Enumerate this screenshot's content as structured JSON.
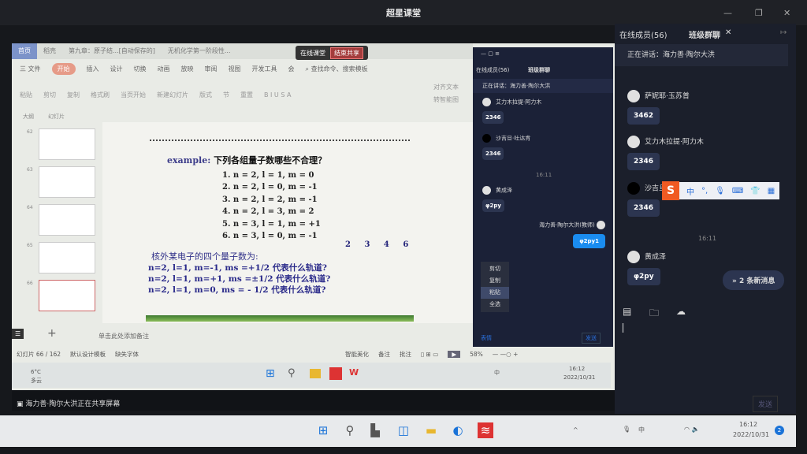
{
  "app": {
    "title": "超星课堂"
  },
  "wps": {
    "tabs": [
      "首页",
      "稻壳",
      "第九章：原子结...[自动保存的]",
      "无机化学第一阶段性..."
    ],
    "live_indicator": "在线课堂",
    "stop_share": "结束共享",
    "menu": [
      "三 文件",
      "开始",
      "插入",
      "设计",
      "切换",
      "动画",
      "放映",
      "审阅",
      "视图",
      "开发工具",
      "会"
    ],
    "search_placeholder": "查找命令、搜索模板",
    "ribbon": [
      "粘贴",
      "剪切",
      "复制",
      "格式刷",
      "当页开始",
      "新建幻灯片",
      "版式",
      "节",
      "重置",
      "对齐文本",
      "转智能图"
    ],
    "outline_tabs": [
      "大纲",
      "幻灯片"
    ],
    "thumb_numbers": [
      "62",
      "63",
      "64",
      "65",
      "66"
    ],
    "notes_placeholder": "单击此处添加备注",
    "status": {
      "slide": "幻灯片 66 / 162",
      "template": "默认设计模板",
      "font": "缺失字体",
      "beautify": "智能美化",
      "notes": "备注",
      "comment": "批注",
      "zoom": "58%"
    }
  },
  "slide": {
    "example_label": "example:",
    "example_question": "下列各组量子数哪些不合理？",
    "items": [
      "1. n = 2, l = 1, m = 0",
      "2. n = 2, l = 0, m = -1",
      "3. n = 2, l = 2, m = -1",
      "4. n = 2, l = 3, m = 2",
      "5. n = 3, l = 1, m = +1",
      "6. n = 3, l = 0, m = -1"
    ],
    "answers": "2 3 4 6",
    "q_title": "核外某电子的四个量子数为:",
    "questions": [
      "n=2, l=1, m=-1, ms =+1/2 代表什么轨道?",
      "n=2, l=1, m=+1, ms =±1/2 代表什么轨道?",
      "n=2, l=1, m=0, ms = - 1/2 代表什么轨道?"
    ]
  },
  "inner_taskbar": {
    "weather_temp": "6°C",
    "weather_desc": "多云",
    "ime": "中",
    "time": "16:12",
    "date": "2022/10/31"
  },
  "inner_chat": {
    "tabs": [
      "在线成员(56)",
      "班级群聊"
    ],
    "speaking": "正在讲话：海力善·陶尔大洪",
    "messages": [
      {
        "name": "艾力木拉提·阿力木",
        "text": "2346"
      },
      {
        "name": "沙吉旦·吐达肯",
        "text": "2346"
      }
    ],
    "time": "16:11",
    "msg2": {
      "name": "黄成泽",
      "text": "φ2py"
    },
    "self": {
      "name": "海力善·陶尔大洪(教师)",
      "text": "φ2py1"
    },
    "context_menu": [
      "剪切",
      "复制",
      "粘贴",
      "全选"
    ],
    "emoji": "表情",
    "send": "发送"
  },
  "share_notice": "海力善·陶尔大洪正在共享屏幕",
  "chat": {
    "tabs": [
      "在线成员(56)",
      "班级群聊"
    ],
    "speaking": "正在讲话：海力善·陶尔大洪",
    "messages": [
      {
        "name": "萨妮耶·玉苏普",
        "text": "3462"
      },
      {
        "name": "艾力木拉提·阿力木",
        "text": "2346"
      },
      {
        "name": "沙吉旦",
        "text": "2346"
      }
    ],
    "time": "16:11",
    "last": {
      "name": "黄成泽",
      "text": "φ2py"
    },
    "new_messages": "2 条新消息",
    "send": "发送",
    "ime": {
      "logo": "S",
      "mode": "中",
      "punct": "°,"
    }
  },
  "taskbar": {
    "time": "16:12",
    "date": "2022/10/31",
    "notifications": "2",
    "ime": "中"
  }
}
